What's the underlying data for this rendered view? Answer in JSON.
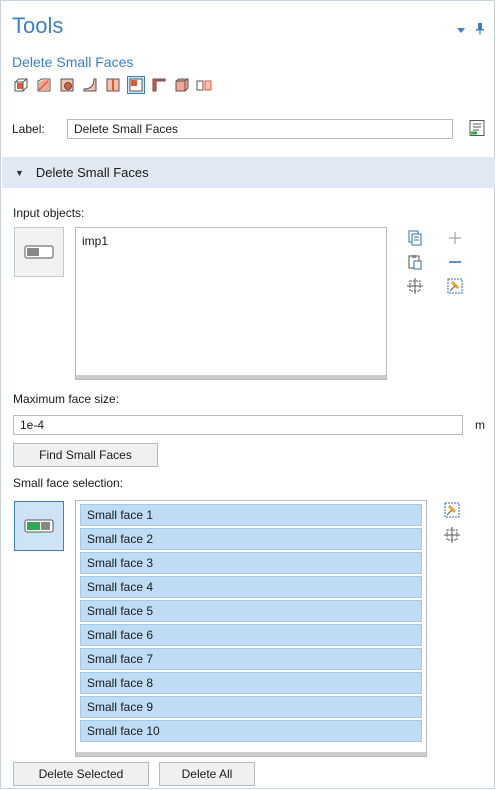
{
  "panel": {
    "title": "Tools",
    "subtitle": "Delete Small Faces",
    "header_icons": [
      "dropdown-arrow-icon",
      "pin-icon"
    ],
    "toolbar_icons": [
      "cap-faces-icon",
      "delete-small-faces-icon",
      "remove-details-icon",
      "delete-fillets-icon",
      "delete-short-edges-icon",
      "delete-small-faces-icon-active",
      "delete-sliver-faces-icon",
      "delete-spikes-icon",
      "delete-small-objects-icon"
    ]
  },
  "label_row": {
    "label": "Label:",
    "value": "Delete Small Faces",
    "icon": "rename-icon"
  },
  "section": {
    "title": "Delete Small Faces"
  },
  "input_objects": {
    "label": "Input objects:",
    "items": [
      "imp1"
    ],
    "side_icons": [
      "copy-icon",
      "add-icon",
      "paste-icon",
      "remove-icon",
      "zoom-to-selection-icon",
      "clear-selection-icon"
    ]
  },
  "max_face_size": {
    "label": "Maximum face size:",
    "value": "1e-4",
    "unit": "m"
  },
  "find_button": {
    "label": "Find Small Faces"
  },
  "small_face_selection": {
    "label": "Small face selection:",
    "items": [
      "Small face 1",
      "Small face 2",
      "Small face 3",
      "Small face 4",
      "Small face 5",
      "Small face 6",
      "Small face 7",
      "Small face 8",
      "Small face 9",
      "Small face 10"
    ]
  },
  "bottom_buttons": {
    "delete_selected": "Delete Selected",
    "delete_all": "Delete All"
  },
  "colors": {
    "accent": "#3a7fc8",
    "section_bg": "#dfe8f3",
    "selected_item": "#bfdcf5"
  }
}
